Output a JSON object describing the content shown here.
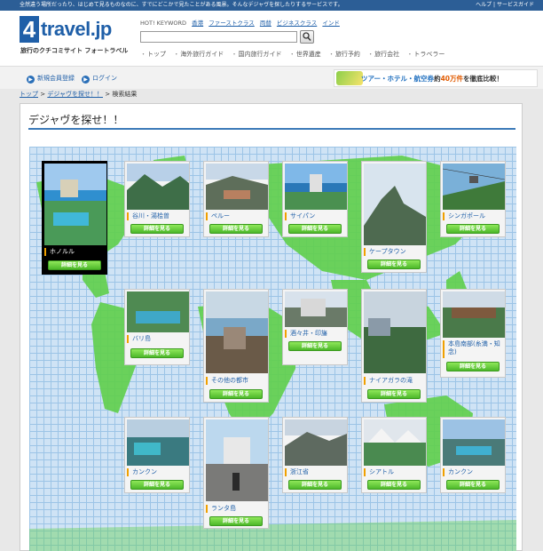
{
  "topbar": {
    "tagline": "全然違う場所だったり、はじめて見るものなのに、すでにどこかで見たことがある風景。そんなデジャヴを探したりするサービスです。",
    "links": [
      "ヘルプ",
      "サービスガイド"
    ]
  },
  "header": {
    "logo_num": "4",
    "logo_text": "travel.jp",
    "logo_sub": "旅行のクチコミサイト フォートラベル",
    "hot_keyword_label": "HOT! KEYWORD",
    "hot_keywords": [
      "香港",
      "ファーストクラス",
      "両替",
      "ビジネスクラス",
      "インド"
    ],
    "search_value": "",
    "nav": [
      "トップ",
      "海外旅行ガイド",
      "国内旅行ガイド",
      "世界遺産",
      "旅行予約",
      "旅行会社",
      "トラベラー"
    ]
  },
  "subbar": {
    "register": "新規会員登録",
    "login": "ログイン",
    "ad_main": "ツアー・ホテル・航空券",
    "ad_mid": "約",
    "ad_num": "40万件",
    "ad_tail": "を徹底比較！"
  },
  "breadcrumb": {
    "items": [
      "トップ",
      "デジャヴを探せ！！"
    ],
    "sep": ">",
    "current": "検索結果"
  },
  "page": {
    "title": "デジャヴを探せ！！",
    "button_label": "詳細を見る"
  },
  "cards": [
    {
      "name": "ホノルル",
      "active": true
    },
    {
      "name": "谷川・湯桧曽"
    },
    {
      "name": "ペルー"
    },
    {
      "name": "サイパン"
    },
    {
      "name": "ケープタウン"
    },
    {
      "name": "シンガポール"
    },
    {
      "name": "バリ島"
    },
    {
      "name": "その他の都市"
    },
    {
      "name": "酒々井・印旛"
    },
    {
      "name": "ナイアガラの滝"
    },
    {
      "name": "本島南部(糸満・知念)"
    },
    {
      "name": "カンクン"
    },
    {
      "name": "ランタ島"
    },
    {
      "name": "浙江省"
    },
    {
      "name": "シアトル"
    },
    {
      "name": "カンクン"
    }
  ],
  "colors": {
    "brand_blue": "#1f5fa8",
    "land_green": "#5fd04a",
    "button_green": "#4cb82a"
  }
}
